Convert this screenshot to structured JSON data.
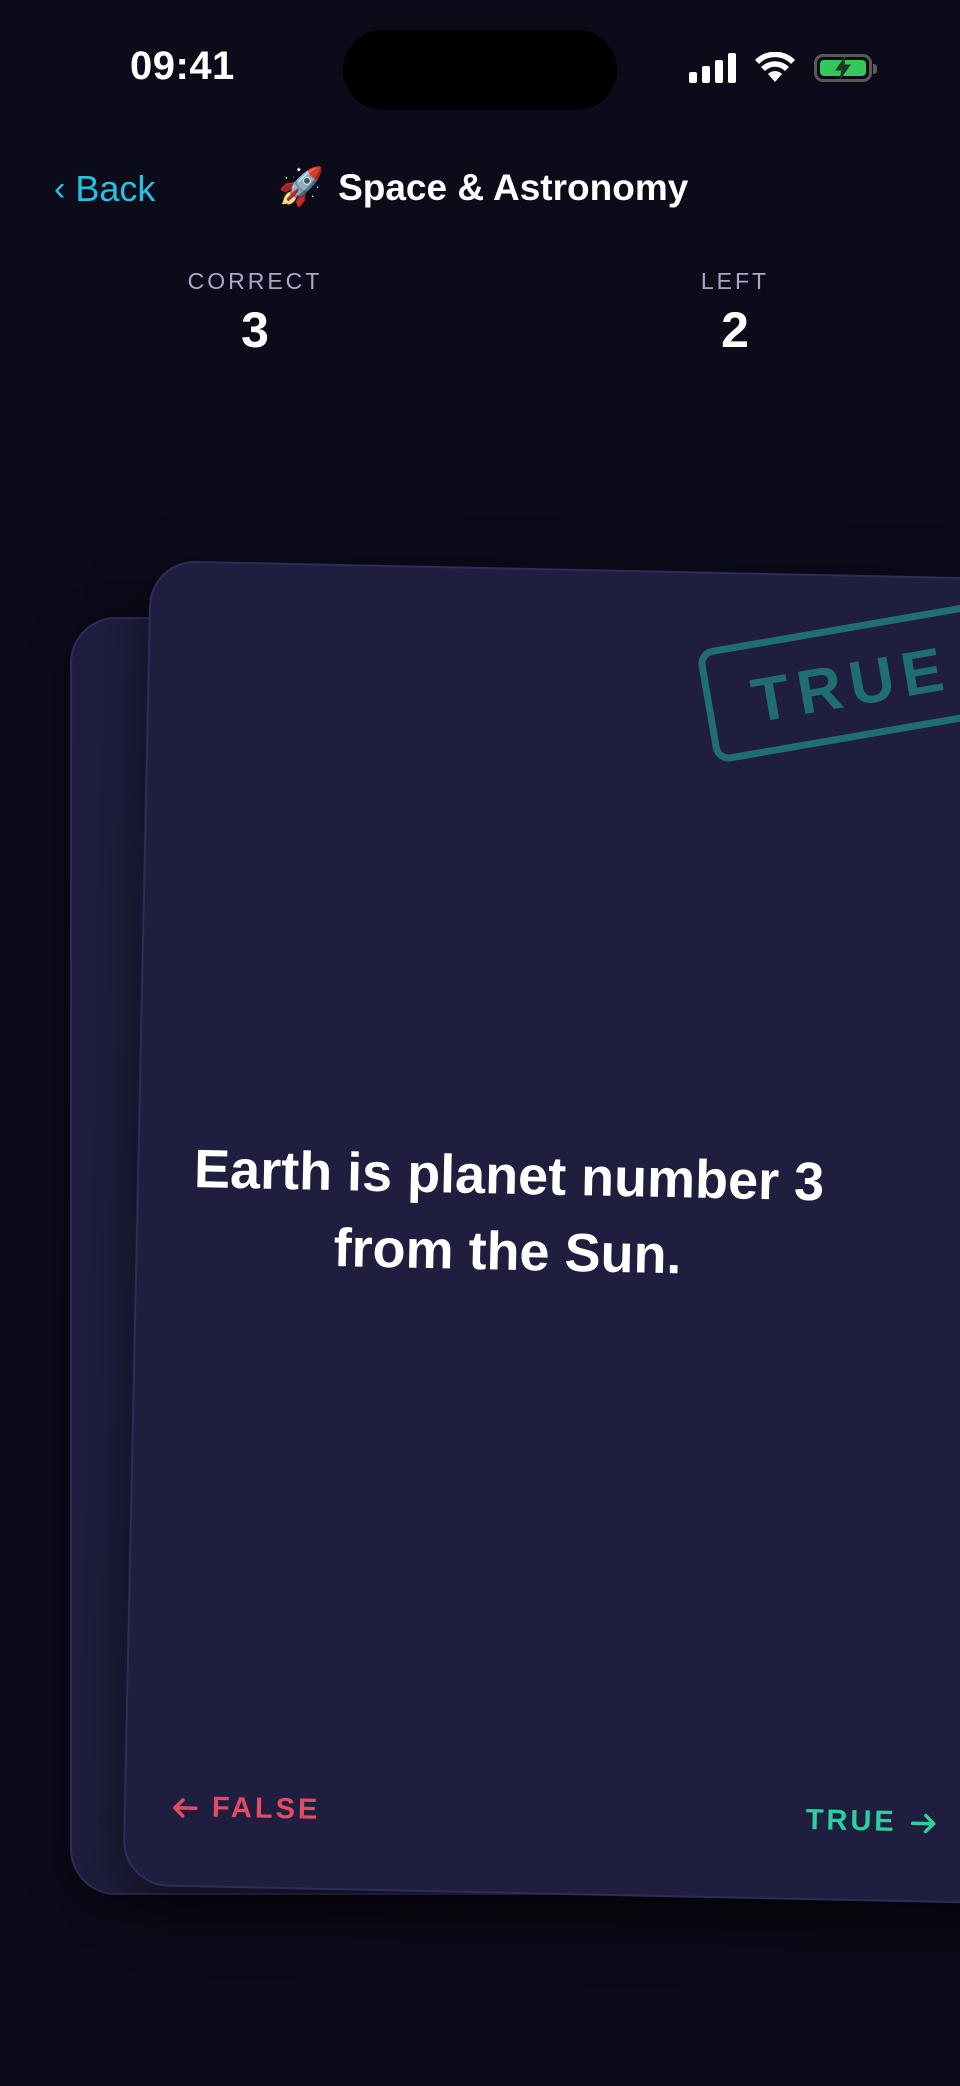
{
  "status_bar": {
    "time": "09:41",
    "icons": [
      "cellular-signal-icon",
      "wifi-icon",
      "battery-charging-icon"
    ],
    "battery_color": "#34c759"
  },
  "header": {
    "back_label": "Back",
    "back_icon": "chevron-left-icon",
    "title_emoji": "🚀",
    "title": "Space & Astronomy"
  },
  "stats": {
    "correct_label": "CORRECT",
    "correct_value": "3",
    "left_label": "LEFT",
    "left_value": "2"
  },
  "card": {
    "stamp": "TRUE",
    "statement": "Earth is planet number 3 from the Sun.",
    "false_label": "FALSE",
    "true_label": "TRUE",
    "back_card_false_arrow": "←"
  },
  "colors": {
    "background": "#0c0b1a",
    "card": "#1f1e3e",
    "accent_blue": "#22c3e6",
    "false_red": "#e14b65",
    "true_green": "#2bd0a1",
    "stamp_teal": "#1f6f70"
  }
}
